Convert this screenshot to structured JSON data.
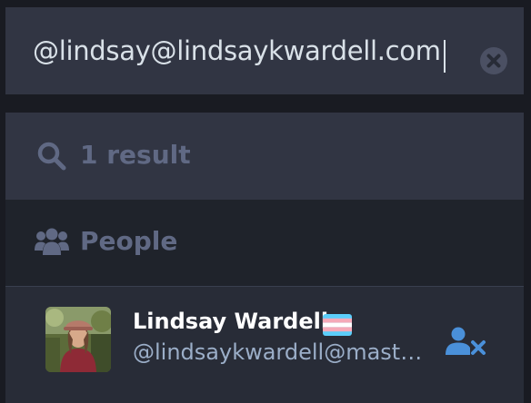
{
  "search": {
    "value": "@lindsay@lindsaykwardell.com",
    "clear_icon": "times-circle-icon"
  },
  "results": {
    "count_label": "1 result",
    "icon": "search-icon",
    "sections": {
      "people": {
        "label": "People",
        "icon": "users-icon"
      }
    }
  },
  "accounts": [
    {
      "display_name": "Lindsay Wardell",
      "flag": "transgender-flag",
      "handle": "@lindsaykwardell@mast…",
      "action_icon": "user-times-icon"
    }
  ],
  "colors": {
    "accent": "#4a90d9",
    "muted": "#606984",
    "secondary_text": "#9baec8"
  }
}
